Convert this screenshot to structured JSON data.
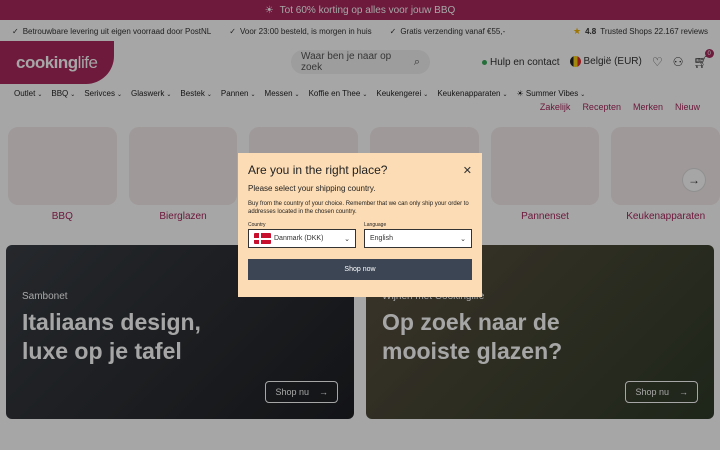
{
  "promo": {
    "icon": "sun-icon",
    "text": "Tot 60% korting op alles voor jouw BBQ"
  },
  "usps": [
    "Betrouwbare levering uit eigen voorraad door PostNL",
    "Voor 23:00 besteld, is morgen in huis",
    "Gratis verzending vanaf €55,-"
  ],
  "trusted": {
    "score": "4.8",
    "text": "Trusted Shops 22.167 reviews"
  },
  "header": {
    "logo_bold": "cooking",
    "logo_thin": "life",
    "search_placeholder": "Waar ben je naar op zoek",
    "help": "Hulp en contact",
    "country": "België (EUR)",
    "cart_count": "0"
  },
  "nav": [
    "Outlet",
    "BBQ",
    "Serivces",
    "Glaswerk",
    "Bestek",
    "Pannen",
    "Messen",
    "Koffie en Thee",
    "Keukengerei",
    "Keukenapparaten",
    "Summer Vibes"
  ],
  "subnav": [
    "Zakelijk",
    "Recepten",
    "Merken",
    "Nieuw"
  ],
  "categories": [
    "BBQ",
    "Bierglazen",
    "",
    "",
    "Pannenset",
    "Keukenapparaten"
  ],
  "banners": [
    {
      "kicker": "Sambonet",
      "headline": "Italiaans design, luxe op je tafel",
      "cta": "Shop nu"
    },
    {
      "kicker": "Wijnen met Cookinglife",
      "headline": "Op zoek naar de mooiste glazen?",
      "cta": "Shop nu"
    }
  ],
  "modal": {
    "title": "Are you in the right place?",
    "subtitle": "Please select your shipping country.",
    "body": "Buy from the country of your choice. Remember that we can only ship your order to addresses located in the chosen country.",
    "country_label": "Country",
    "country_value": "Danmark (DKK)",
    "language_label": "Language",
    "language_value": "English",
    "button": "Shop now"
  },
  "colors": {
    "brand": "#a8285c",
    "modal_bg": "#fcdcb4",
    "button": "#3b4554"
  }
}
